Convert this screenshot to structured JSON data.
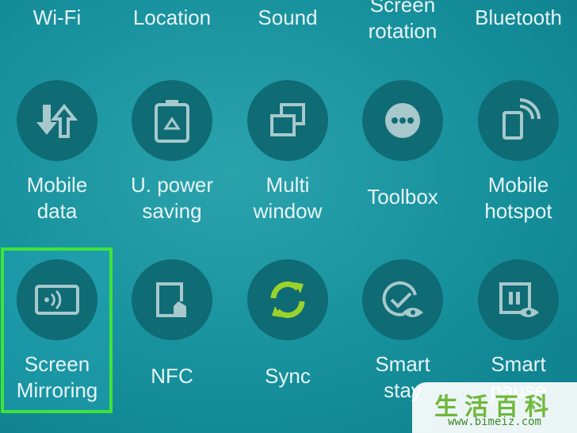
{
  "top_row": {
    "items": [
      {
        "label": "Wi-Fi"
      },
      {
        "label": "Location"
      },
      {
        "label": "Sound"
      },
      {
        "label": "Screen\nrotation"
      },
      {
        "label": "Bluetooth"
      }
    ]
  },
  "middle_row": {
    "items": [
      {
        "label": "Mobile\ndata",
        "icon": "data-transfer-icon"
      },
      {
        "label": "U. power\nsaving",
        "icon": "battery-recycle-icon"
      },
      {
        "label": "Multi\nwindow",
        "icon": "multi-window-icon"
      },
      {
        "label": "Toolbox",
        "icon": "toolbox-dots-icon"
      },
      {
        "label": "Mobile\nhotspot",
        "icon": "hotspot-icon"
      }
    ]
  },
  "bottom_row": {
    "items": [
      {
        "label": "Screen\nMirroring",
        "icon": "screen-mirroring-icon",
        "highlighted": true
      },
      {
        "label": "NFC",
        "icon": "nfc-icon"
      },
      {
        "label": "Sync",
        "icon": "sync-icon",
        "active": true
      },
      {
        "label": "Smart\nstay",
        "icon": "smart-stay-icon"
      },
      {
        "label": "Smart\npause",
        "icon": "smart-pause-icon"
      }
    ]
  },
  "colors": {
    "background": "#16909c",
    "tile": "#0f6b74",
    "icon": "#a7c9cc",
    "sync_active": "#9bd22b",
    "highlight_border": "#3ee43a"
  },
  "watermark": {
    "chars": "生活百科",
    "url": "www.bimeiz.com"
  }
}
